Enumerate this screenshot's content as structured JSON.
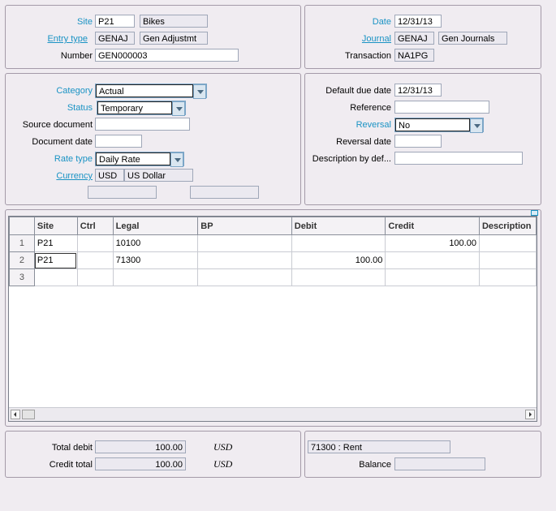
{
  "header_left": {
    "site_label": "Site",
    "site_code": "P21",
    "site_name": "Bikes",
    "entry_type_label": "Entry type",
    "entry_type_code": "GENAJ",
    "entry_type_name": "Gen Adjustmt",
    "number_label": "Number",
    "number_value": "GEN000003"
  },
  "header_right": {
    "date_label": "Date",
    "date_value": "12/31/13",
    "journal_label": "Journal",
    "journal_code": "GENAJ",
    "journal_name": "Gen Journals",
    "transaction_label": "Transaction",
    "transaction_value": "NA1PG"
  },
  "mid_left": {
    "category_label": "Category",
    "category_value": "Actual",
    "status_label": "Status",
    "status_value": "Temporary",
    "source_document_label": "Source document",
    "source_document_value": "",
    "document_date_label": "Document date",
    "document_date_value": "",
    "rate_type_label": "Rate type",
    "rate_type_value": "Daily Rate",
    "currency_label": "Currency",
    "currency_code": "USD",
    "currency_name": "US Dollar"
  },
  "mid_right": {
    "default_due_date_label": "Default due date",
    "default_due_date_value": "12/31/13",
    "reference_label": "Reference",
    "reference_value": "",
    "reversal_label": "Reversal",
    "reversal_value": "No",
    "reversal_date_label": "Reversal date",
    "reversal_date_value": "",
    "description_label": "Description by def...",
    "description_value": ""
  },
  "grid": {
    "columns": [
      "Site",
      "Ctrl",
      "Legal",
      "BP",
      "Debit",
      "Credit",
      "Description"
    ],
    "rows": [
      {
        "num": "1",
        "site": "P21",
        "ctrl": "",
        "legal": "10100",
        "bp": "",
        "debit": "",
        "credit": "100.00",
        "description": ""
      },
      {
        "num": "2",
        "site": "P21",
        "ctrl": "",
        "legal": "71300",
        "bp": "",
        "debit": "100.00",
        "credit": "",
        "description": ""
      },
      {
        "num": "3",
        "site": "",
        "ctrl": "",
        "legal": "",
        "bp": "",
        "debit": "",
        "credit": "",
        "description": ""
      }
    ]
  },
  "footer_left": {
    "total_debit_label": "Total debit",
    "total_debit_value": "100.00",
    "total_debit_currency": "USD",
    "credit_total_label": "Credit total",
    "credit_total_value": "100.00",
    "credit_total_currency": "USD"
  },
  "footer_right": {
    "account_info": "71300 : Rent",
    "balance_label": "Balance",
    "balance_value": ""
  },
  "colors": {
    "link": "#1a93c4",
    "background": "#f0ecf1",
    "border": "#a49aa8"
  }
}
